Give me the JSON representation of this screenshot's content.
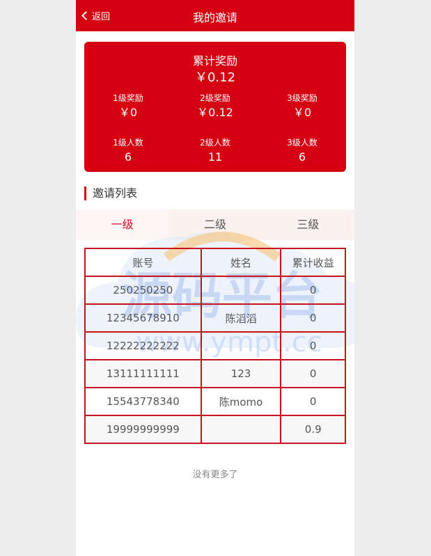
{
  "header": {
    "back_label": "返回",
    "title": "我的邀请"
  },
  "summary": {
    "total_label": "累计奖励",
    "total_value": "￥0.12",
    "stats": [
      {
        "label": "1级奖励",
        "value": "￥0"
      },
      {
        "label": "2级奖励",
        "value": "￥0.12"
      },
      {
        "label": "3级奖励",
        "value": "￥0"
      },
      {
        "label": "1级人数",
        "value": "6"
      },
      {
        "label": "2级人数",
        "value": "11"
      },
      {
        "label": "3级人数",
        "value": "6"
      }
    ]
  },
  "section_title": "邀请列表",
  "tabs": [
    {
      "label": "一级",
      "active": true
    },
    {
      "label": "二级",
      "active": false
    },
    {
      "label": "三级",
      "active": false
    }
  ],
  "table": {
    "columns": [
      "账号",
      "姓名",
      "累计收益"
    ],
    "rows": [
      [
        "250250250",
        "",
        "0"
      ],
      [
        "12345678910",
        "陈滔滔",
        "0"
      ],
      [
        "12222222222",
        "",
        "0"
      ],
      [
        "13111111111",
        "123",
        "0"
      ],
      [
        "15543778340",
        "陈momo",
        "0"
      ],
      [
        "19999999999",
        "",
        "0.9"
      ]
    ]
  },
  "footer_text": "没有更多了",
  "watermark": {
    "title": "源码平台",
    "url": "www.ympt.cc"
  },
  "colors": {
    "brand_red": "#d50012",
    "table_border": "#c8101e",
    "active_tab": "#c8102e"
  }
}
